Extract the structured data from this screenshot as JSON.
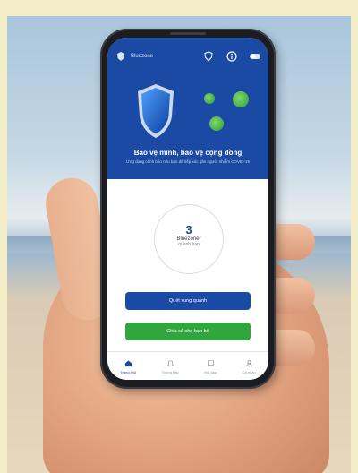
{
  "app": {
    "brand": "Bluezone",
    "slogan": "Bảo vệ mình, bảo vệ cộng đồng",
    "subtitle": "Ứng dụng cảnh báo nếu bạn đã tiếp xúc gần người nhiễm COVID-19",
    "counter": {
      "number": "3",
      "label": "Bluezoner",
      "sub": "quanh bạn"
    },
    "buttons": {
      "primary": "Quét xung quanh",
      "secondary": "Chia sẻ cho bạn bè"
    },
    "nav": [
      {
        "label": "Trang chủ",
        "icon": "home-icon",
        "active": true
      },
      {
        "label": "Thông báo",
        "icon": "bell-icon",
        "active": false
      },
      {
        "label": "Hỏi đáp",
        "icon": "chat-icon",
        "active": false
      },
      {
        "label": "Cá nhân",
        "icon": "user-icon",
        "active": false
      }
    ]
  },
  "colors": {
    "primary": "#1a4aa3",
    "accent_green": "#33a53f"
  }
}
